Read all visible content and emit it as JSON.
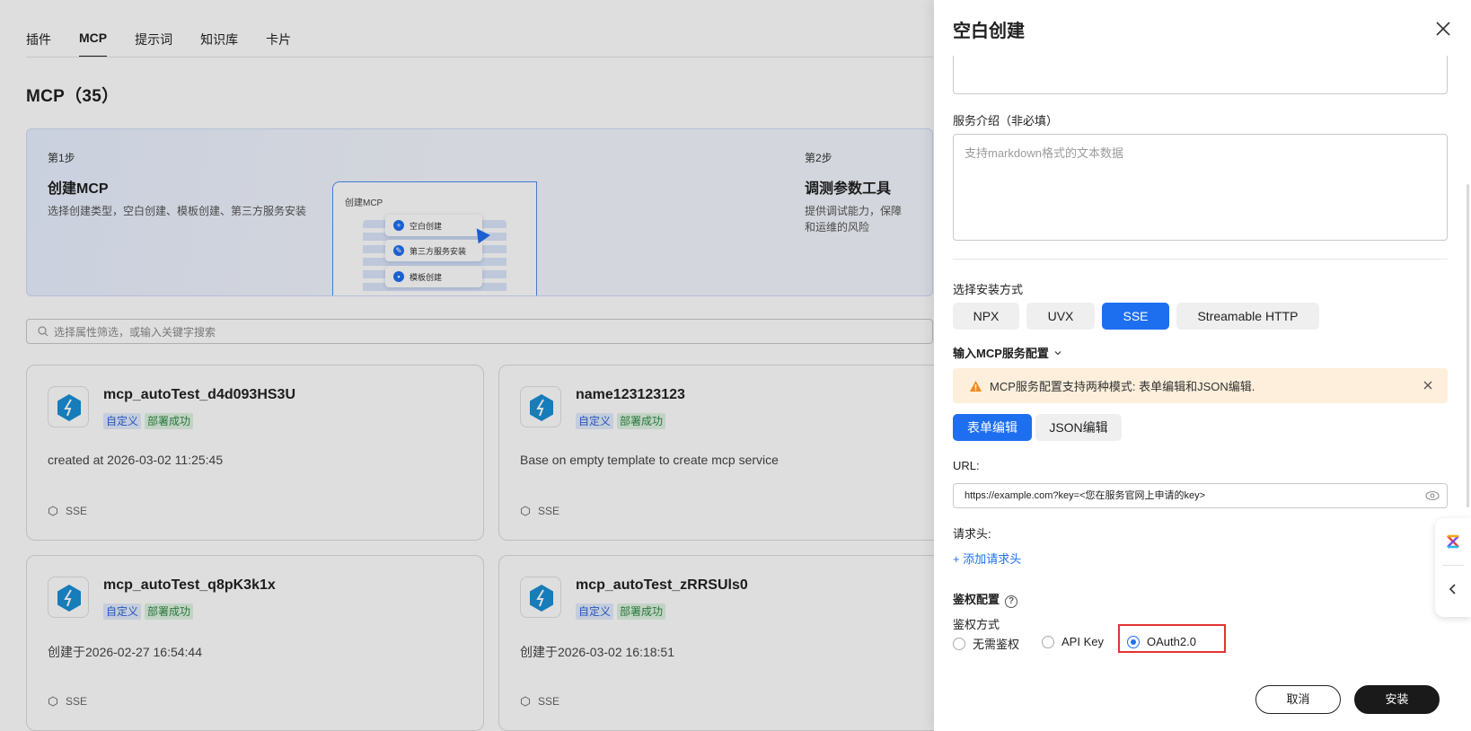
{
  "tabs": [
    "插件",
    "MCP",
    "提示词",
    "知识库",
    "卡片"
  ],
  "active_tab_index": 1,
  "page_title": "MCP（35）",
  "guide": {
    "step1": {
      "step": "第1步",
      "title": "创建MCP",
      "desc": "选择创建类型，空白创建、模板创建、第三方服务安装"
    },
    "illustration": {
      "title": "创建MCP",
      "items": [
        "空白创建",
        "第三方服务安装",
        "模板创建"
      ]
    },
    "step2": {
      "step": "第2步",
      "title": "调测参数工具",
      "desc_line1": "提供调试能力，保障",
      "desc_line2": "和运维的风险"
    }
  },
  "search": {
    "placeholder": "选择属性筛选，或输入关键字搜索"
  },
  "cards": [
    {
      "name": "mcp_autoTest_d4d093HS3U",
      "tags": [
        "自定义",
        "部署成功"
      ],
      "desc": "created at 2026-03-02 11:25:45",
      "type": "SSE"
    },
    {
      "name": "name123123123",
      "tags": [
        "自定义",
        "部署成功"
      ],
      "desc": "Base on empty template to create mcp service",
      "type": "SSE"
    },
    {
      "name": "mcp_autoTest_q8pK3k1x",
      "tags": [
        "自定义",
        "部署成功"
      ],
      "desc": "创建于2026-02-27 16:54:44",
      "type": "SSE"
    },
    {
      "name": "mcp_autoTest_zRRSUls0",
      "tags": [
        "自定义",
        "部署成功"
      ],
      "desc": "创建于2026-03-02 16:18:51",
      "type": "SSE"
    }
  ],
  "drawer": {
    "title": "空白创建",
    "service_intro_label": "服务介绍（非必填）",
    "service_intro_placeholder": "支持markdown格式的文本数据",
    "install_method_label": "选择安装方式",
    "install_methods": [
      "NPX",
      "UVX",
      "SSE",
      "Streamable HTTP"
    ],
    "install_method_selected": "SSE",
    "config_title": "输入MCP服务配置",
    "alert_text": "MCP服务配置支持两种模式: 表单编辑和JSON编辑.",
    "edit_modes": [
      "表单编辑",
      "JSON编辑"
    ],
    "edit_mode_selected": "表单编辑",
    "url_label": "URL:",
    "url_value": "https://example.com?key=<您在服务官网上申请的key>",
    "headers_label": "请求头:",
    "add_header": "+ 添加请求头",
    "auth_config_label": "鉴权配置",
    "auth_method_label": "鉴权方式",
    "auth_options": [
      "无需鉴权",
      "API Key",
      "OAuth2.0"
    ],
    "auth_selected": "OAuth2.0",
    "cancel": "取消",
    "install": "安装"
  },
  "colors": {
    "primary": "#1e6ff0",
    "warning_bg": "#fdefdb",
    "highlight": "#e23333"
  },
  "icons": [
    "search-icon",
    "close-icon",
    "warning-icon",
    "eye-icon",
    "help-icon",
    "chevron-down-icon",
    "chevron-left-icon",
    "mcp-logo-icon",
    "sse-icon",
    "app-logo-icon"
  ]
}
